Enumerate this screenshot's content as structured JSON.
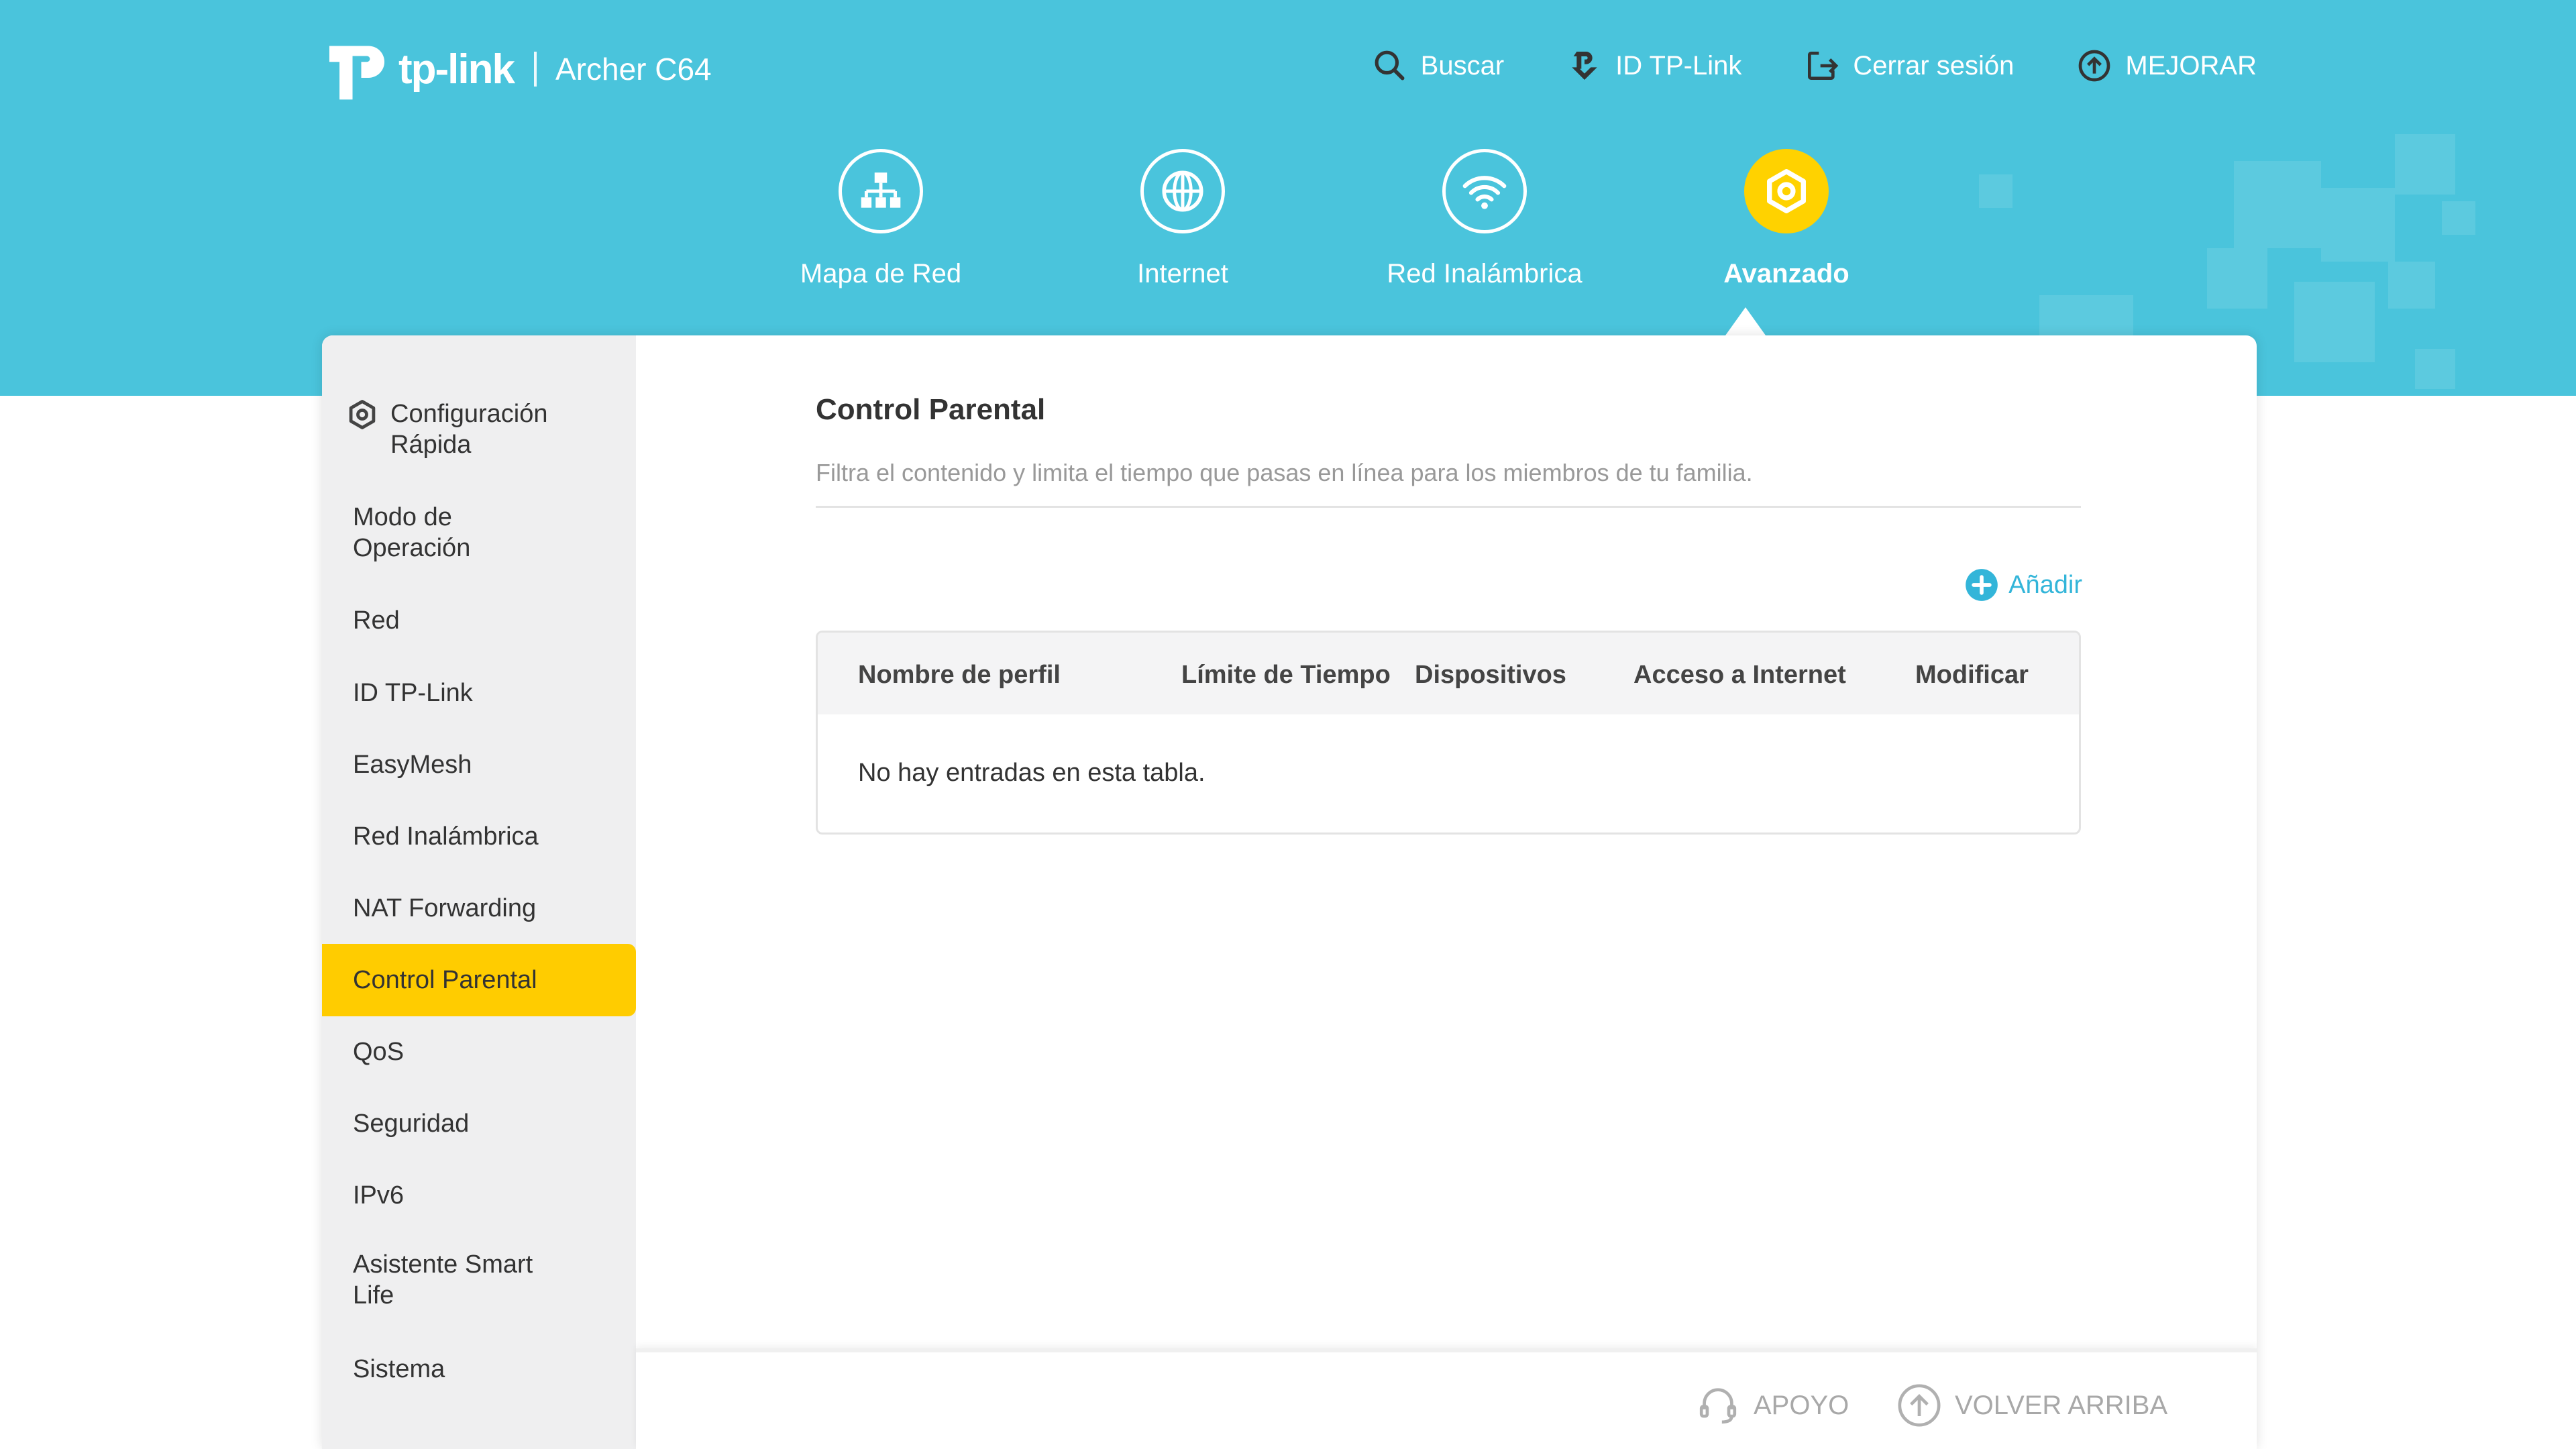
{
  "header": {
    "brand": "tp-link",
    "model": "Archer C64",
    "links": [
      {
        "label": "Buscar",
        "icon": "search-icon"
      },
      {
        "label": "ID TP-Link",
        "icon": "tplink-id-icon"
      },
      {
        "label": "Cerrar sesión",
        "icon": "logout-icon"
      },
      {
        "label": "MEJORAR",
        "icon": "upgrade-icon"
      }
    ]
  },
  "nav": {
    "items": [
      {
        "label": "Mapa de Red",
        "icon": "network-map-icon"
      },
      {
        "label": "Internet",
        "icon": "globe-icon"
      },
      {
        "label": "Red Inalámbrica",
        "icon": "wifi-icon"
      },
      {
        "label": "Avanzado",
        "icon": "gear-icon",
        "active": true
      }
    ]
  },
  "sidebar": {
    "items": [
      {
        "label": "Configuración\nRápida",
        "icon": "gear-icon"
      },
      {
        "label": "Modo de\nOperación"
      },
      {
        "label": "Red"
      },
      {
        "label": "ID TP-Link"
      },
      {
        "label": "EasyMesh"
      },
      {
        "label": "Red Inalámbrica"
      },
      {
        "label": "NAT Forwarding"
      },
      {
        "label": "Control Parental",
        "active": true
      },
      {
        "label": "QoS"
      },
      {
        "label": "Seguridad"
      },
      {
        "label": "IPv6"
      },
      {
        "label": "Asistente Smart\nLife"
      },
      {
        "label": "Sistema"
      }
    ]
  },
  "main": {
    "title": "Control Parental",
    "description": "Filtra el contenido y limita el tiempo que pasas en línea para los miembros de tu familia.",
    "add_label": "Añadir",
    "table": {
      "columns": [
        "Nombre de perfil",
        "Límite de Tiempo",
        "Dispositivos",
        "Acceso a Internet",
        "Modificar"
      ],
      "empty_text": "No hay entradas en esta tabla."
    }
  },
  "footer": {
    "support_label": "APOYO",
    "back_top_label": "VOLVER ARRIBA"
  },
  "colors": {
    "header_bg": "#4ac4dc",
    "accent_yellow": "#ffcc00",
    "link_blue": "#33b5d9"
  }
}
